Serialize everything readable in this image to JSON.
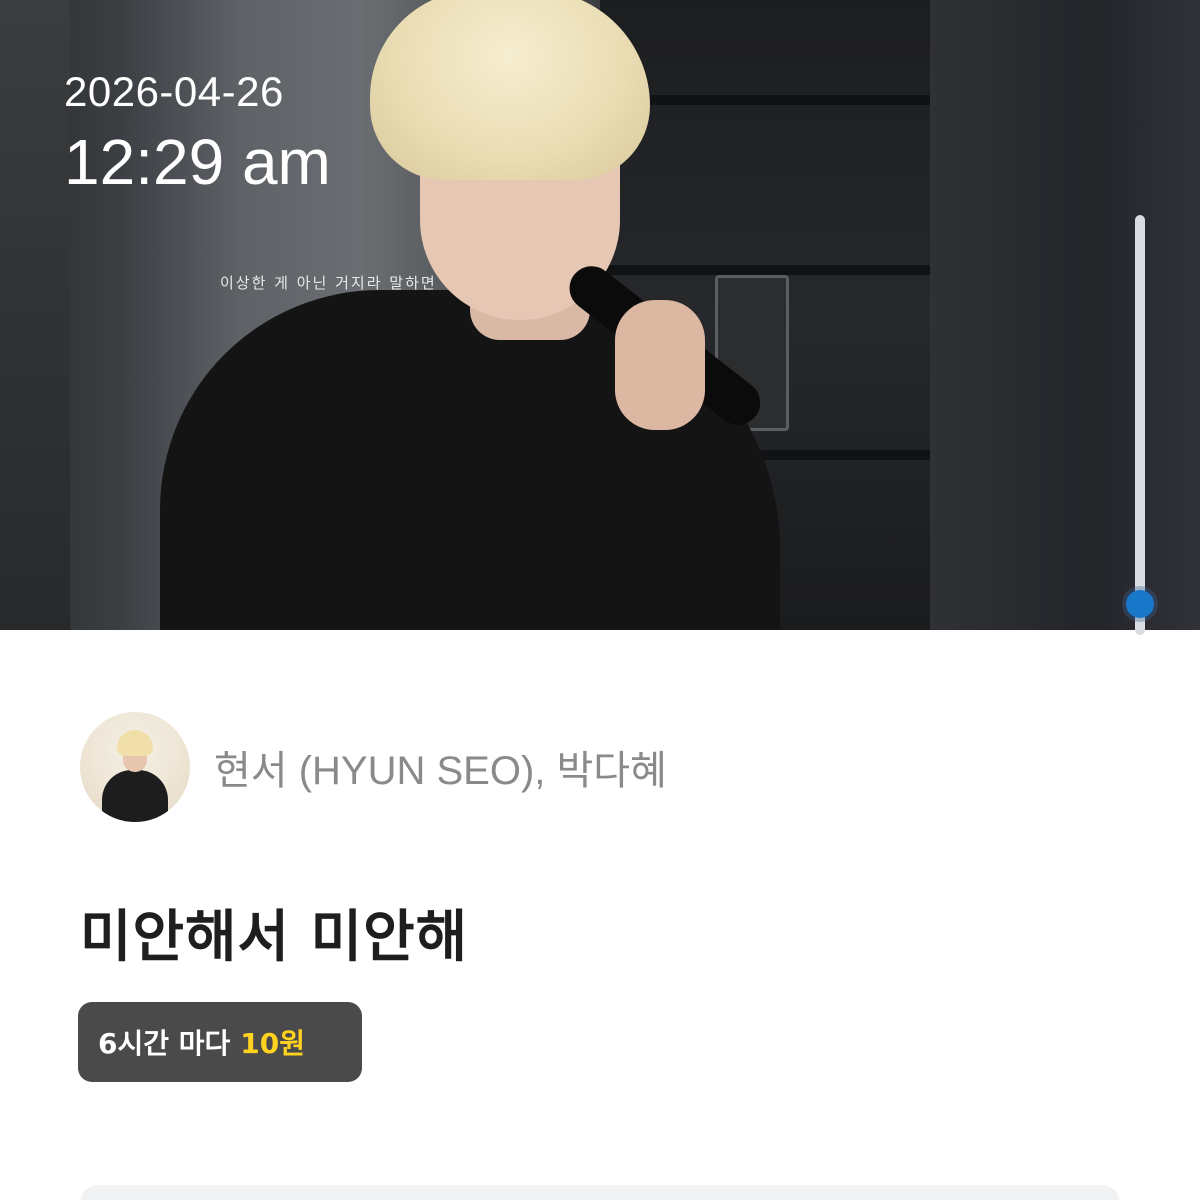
{
  "status": {
    "date": "2026-04-26",
    "time": "12:29 am"
  },
  "video": {
    "lyric_caption": "이상한 게 아닌 거지라 말하면",
    "scroll_position": 0.95
  },
  "track": {
    "artist": "현서 (HYUN SEO), 박다혜",
    "title": "미안해서 미안해"
  },
  "price": {
    "period_label": "6시간 마다",
    "amount": "10원"
  },
  "colors": {
    "accent_blue": "#1877c9",
    "price_yellow": "#ffd21f",
    "badge_bg": "#4a4a4a"
  }
}
